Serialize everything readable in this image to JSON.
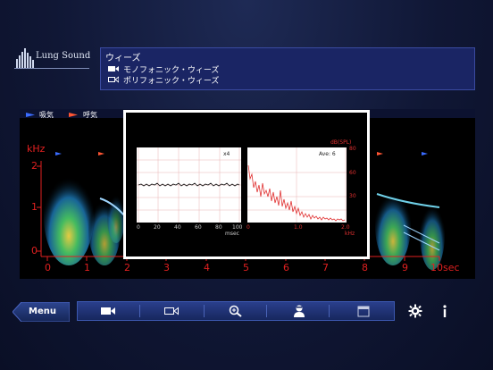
{
  "app": {
    "logo_text": "Lung Sound"
  },
  "info_panel": {
    "title": "ウィーズ",
    "items": [
      {
        "icon": "video-camera-icon",
        "label": "モノフォニック・ウィーズ"
      },
      {
        "icon": "video-outline-icon",
        "label": "ポリフォニック・ウィーズ"
      }
    ]
  },
  "legend": {
    "inhale": "吸気",
    "exhale": "呼気",
    "inhale_color": "#3a6cff",
    "exhale_color": "#ff5533"
  },
  "spectrogram": {
    "y_unit": "kHz",
    "y_ticks": [
      "2",
      "1",
      "0"
    ],
    "x_ticks": [
      "0",
      "1",
      "2",
      "3",
      "4",
      "5",
      "6",
      "7",
      "8",
      "9",
      "10sec"
    ],
    "accent_color": "#e02020"
  },
  "popup": {
    "waveform": {
      "scale_label": "x4",
      "x_ticks": [
        "0",
        "20",
        "40",
        "60",
        "80",
        "100"
      ],
      "x_unit": "msec"
    },
    "spectrum": {
      "y_unit": "dB(SPL)",
      "ave_label": "Ave: 6",
      "y_ticks": [
        "80",
        "60",
        "30"
      ],
      "x_ticks": [
        "0",
        "1.0",
        "2.0"
      ],
      "x_unit": "kHz"
    }
  },
  "toolbar": {
    "menu_label": "Menu",
    "tools": [
      "video-camera-icon",
      "video-outline-icon",
      "zoom-icon",
      "doctor-icon",
      "window-icon"
    ],
    "settings_icon": "gear-icon",
    "info_icon": "info-icon"
  }
}
